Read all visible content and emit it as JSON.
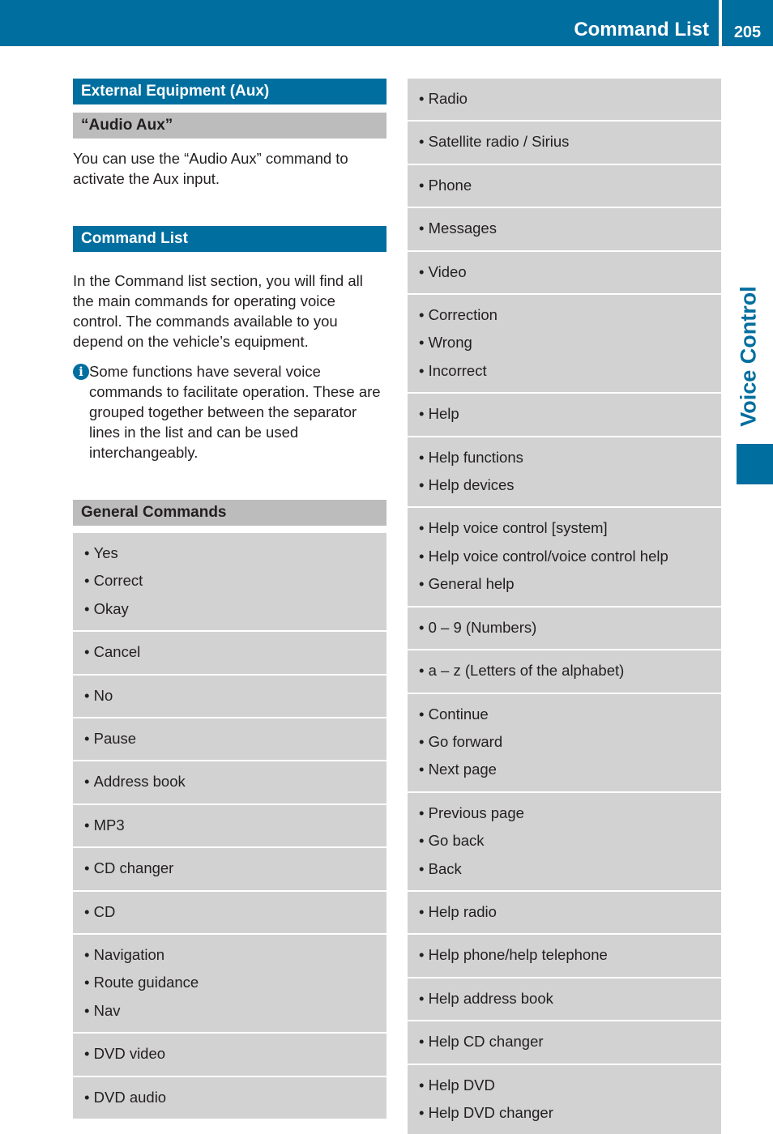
{
  "header": {
    "title": "Command List",
    "page_number": "205",
    "section_tab": "Voice Control"
  },
  "colors": {
    "brand_blue": "#006e9f",
    "heading_gray": "#bcbcbc",
    "list_gray": "#d2d2d2"
  },
  "left": {
    "aux_heading": "External Equipment (Aux)",
    "audio_aux_heading": "“Audio Aux”",
    "audio_aux_text": "You can use the “Audio Aux” command to activate the Aux input.",
    "command_list_heading": "Command List",
    "command_list_text": "In the Command list section, you will find all the main commands for operating voice control. The commands available to you depend on the vehicle’s equipment.",
    "note_icon": "info-icon",
    "note_text": "Some functions have several voice commands to facilitate operation. These are grouped together between the separator lines in the list and can be used interchangeably.",
    "general_heading": "General Commands",
    "groups": [
      [
        "Yes",
        "Correct",
        "Okay"
      ],
      [
        "Cancel"
      ],
      [
        "No"
      ],
      [
        "Pause"
      ],
      [
        "Address book"
      ],
      [
        "MP3"
      ],
      [
        "CD changer"
      ],
      [
        "CD"
      ],
      [
        "Navigation",
        "Route guidance",
        "Nav"
      ],
      [
        "DVD video"
      ],
      [
        "DVD audio"
      ]
    ]
  },
  "right": {
    "groups": [
      [
        "Radio"
      ],
      [
        "Satellite radio / Sirius"
      ],
      [
        "Phone"
      ],
      [
        "Messages"
      ],
      [
        "Video"
      ],
      [
        "Correction",
        "Wrong",
        "Incorrect"
      ],
      [
        "Help"
      ],
      [
        "Help functions",
        "Help devices"
      ],
      [
        "Help voice control [system]",
        "Help voice control/voice control help",
        "General help"
      ],
      [
        "0 – 9 (Numbers)"
      ],
      [
        "a – z (Letters of the alphabet)"
      ],
      [
        "Continue",
        "Go forward",
        "Next page"
      ],
      [
        "Previous page",
        "Go back",
        "Back"
      ],
      [
        "Help radio"
      ],
      [
        "Help phone/help telephone"
      ],
      [
        "Help address book"
      ],
      [
        "Help CD changer"
      ],
      [
        "Help DVD",
        "Help DVD changer"
      ]
    ]
  }
}
